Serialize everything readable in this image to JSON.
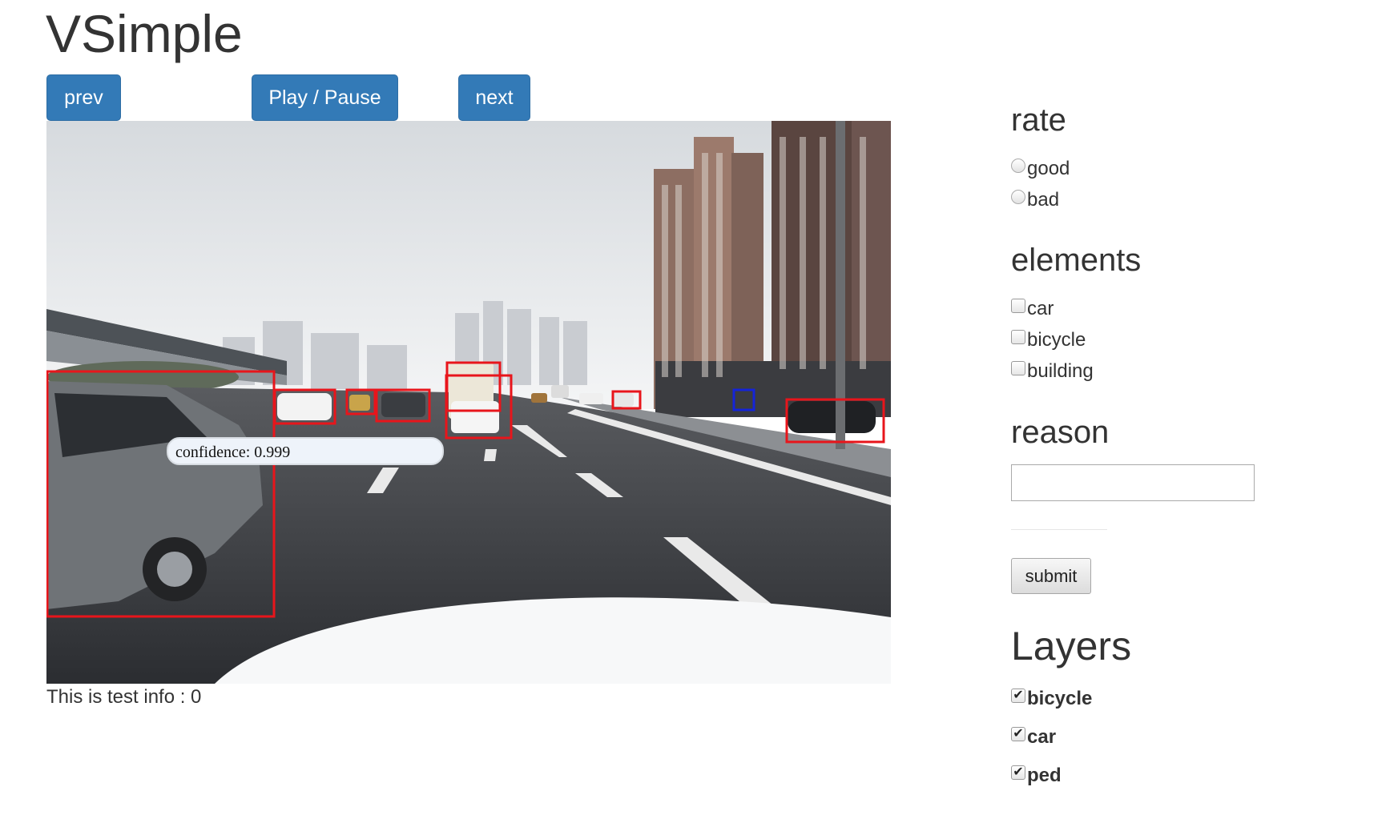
{
  "app": {
    "title": "VSimple"
  },
  "nav": {
    "prev_label": "prev",
    "play_pause_label": "Play / Pause",
    "next_label": "next"
  },
  "viewer": {
    "tooltip": "confidence: 0.999",
    "info": "This is test info : 0",
    "box_colors": {
      "detection": "#e8151b",
      "pedestrian": "#1424d8"
    },
    "detections": [
      {
        "label": "car",
        "color": "detection"
      },
      {
        "label": "car",
        "color": "detection"
      },
      {
        "label": "car",
        "color": "detection"
      },
      {
        "label": "car",
        "color": "detection"
      },
      {
        "label": "car",
        "color": "detection"
      },
      {
        "label": "car",
        "color": "detection"
      },
      {
        "label": "car",
        "color": "detection"
      },
      {
        "label": "car",
        "color": "detection"
      },
      {
        "label": "ped",
        "color": "pedestrian"
      }
    ]
  },
  "rate": {
    "heading": "rate",
    "options": [
      {
        "label": "good",
        "checked": false
      },
      {
        "label": "bad",
        "checked": false
      }
    ]
  },
  "elements": {
    "heading": "elements",
    "options": [
      {
        "label": "car",
        "checked": false
      },
      {
        "label": "bicycle",
        "checked": false
      },
      {
        "label": "building",
        "checked": false
      }
    ]
  },
  "reason": {
    "heading": "reason",
    "value": "",
    "submit_label": "submit"
  },
  "layers": {
    "heading": "Layers",
    "options": [
      {
        "label": "bicycle",
        "checked": true
      },
      {
        "label": "car",
        "checked": true
      },
      {
        "label": "ped",
        "checked": true
      }
    ]
  },
  "colors": {
    "primary_button": "#337ab7",
    "text": "#333333"
  }
}
